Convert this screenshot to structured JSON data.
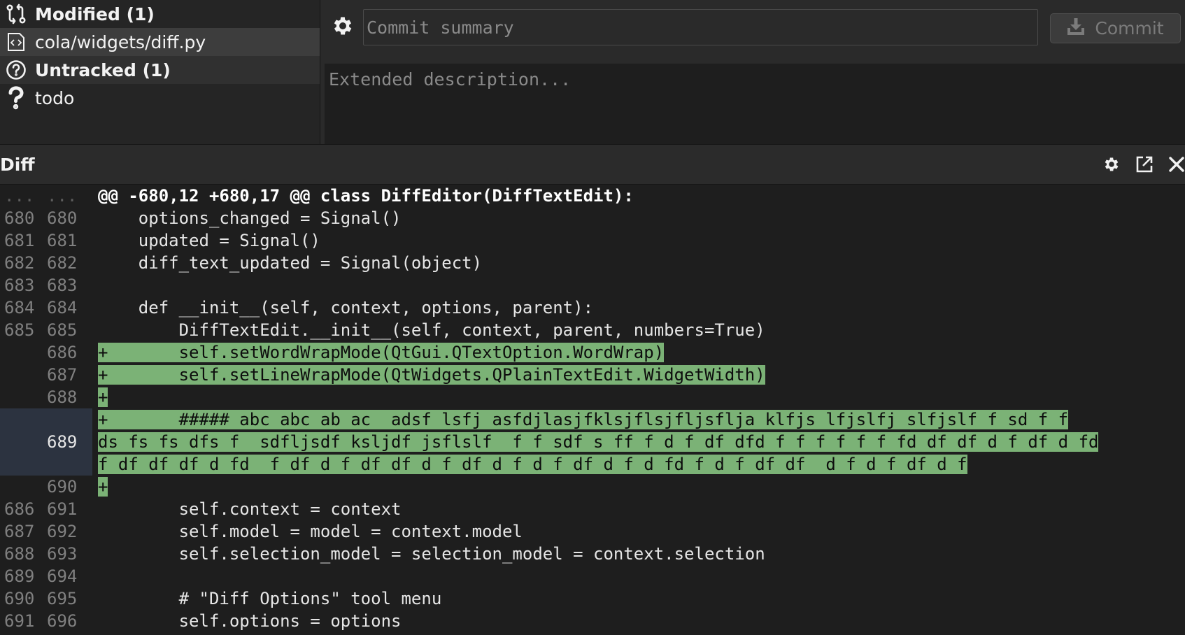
{
  "status_tree": {
    "modified_header": "Modified (1)",
    "modified_file": "cola/widgets/diff.py",
    "untracked_header": "Untracked (1)",
    "untracked_file": "todo"
  },
  "commit": {
    "summary_placeholder": "Commit summary",
    "description_placeholder": "Extended description...",
    "commit_label": "Commit"
  },
  "diff": {
    "title": "Diff",
    "hunk_header": "@@ -680,12 +680,17 @@ class DiffEditor(DiffTextEdit):",
    "gutter_ellipsis": "...",
    "lines": [
      {
        "old": "680",
        "new": "680",
        "type": "ctx",
        "text": "    options_changed = Signal()"
      },
      {
        "old": "681",
        "new": "681",
        "type": "ctx",
        "text": "    updated = Signal()"
      },
      {
        "old": "682",
        "new": "682",
        "type": "ctx",
        "text": "    diff_text_updated = Signal(object)"
      },
      {
        "old": "683",
        "new": "683",
        "type": "ctx",
        "text": ""
      },
      {
        "old": "684",
        "new": "684",
        "type": "ctx",
        "text": "    def __init__(self, context, options, parent):"
      },
      {
        "old": "685",
        "new": "685",
        "type": "ctx",
        "text": "        DiffTextEdit.__init__(self, context, parent, numbers=True)"
      },
      {
        "old": "",
        "new": "686",
        "type": "add",
        "text": "+       self.setWordWrapMode(QtGui.QTextOption.WordWrap)"
      },
      {
        "old": "",
        "new": "687",
        "type": "add",
        "text": "+       self.setLineWrapMode(QtWidgets.QPlainTextEdit.WidgetWidth)"
      },
      {
        "old": "",
        "new": "688",
        "type": "add",
        "text": "+"
      },
      {
        "old": "",
        "new": "689",
        "type": "add-wrapped",
        "current": true,
        "text": [
          "+       ##### abc abc ab ac  adsf lsfj asfdjlasjfklsjflsjfljsflja klfjs lfjslfj slfjslf f sd f f",
          "ds fs fs dfs f  sdfljsdf ksljdf jsflslf  f f sdf s ff f d f df dfd f f f f f f fd df df d f df d fd",
          "f df df df d fd  f df d f df df d f df d f d f df d f d fd f d f df df  d f d f df d f"
        ]
      },
      {
        "old": "",
        "new": "690",
        "type": "add",
        "text": "+"
      },
      {
        "old": "686",
        "new": "691",
        "type": "ctx",
        "text": "        self.context = context"
      },
      {
        "old": "687",
        "new": "692",
        "type": "ctx",
        "text": "        self.model = model = context.model"
      },
      {
        "old": "688",
        "new": "693",
        "type": "ctx",
        "text": "        self.selection_model = selection_model = context.selection"
      },
      {
        "old": "689",
        "new": "694",
        "type": "ctx",
        "text": ""
      },
      {
        "old": "690",
        "new": "695",
        "type": "ctx",
        "text": "        # \"Diff Options\" tool menu"
      },
      {
        "old": "691",
        "new": "696",
        "type": "ctx",
        "text": "        self.options = options"
      }
    ]
  },
  "colors": {
    "added_line_bg": "#7bb276",
    "current_line_gutter": "#2c3340",
    "panel_bg": "#252525",
    "editor_bg": "#1e1e1e"
  },
  "icons": {
    "modified": "git-compare-icon",
    "file": "code-file-icon",
    "untracked": "question-circle-icon",
    "untracked_file": "question-mark-icon",
    "commit_options": "gear-icon",
    "commit_button": "download-icon",
    "dock_settings": "gear-icon",
    "dock_float": "external-link-icon",
    "dock_close": "close-icon"
  }
}
